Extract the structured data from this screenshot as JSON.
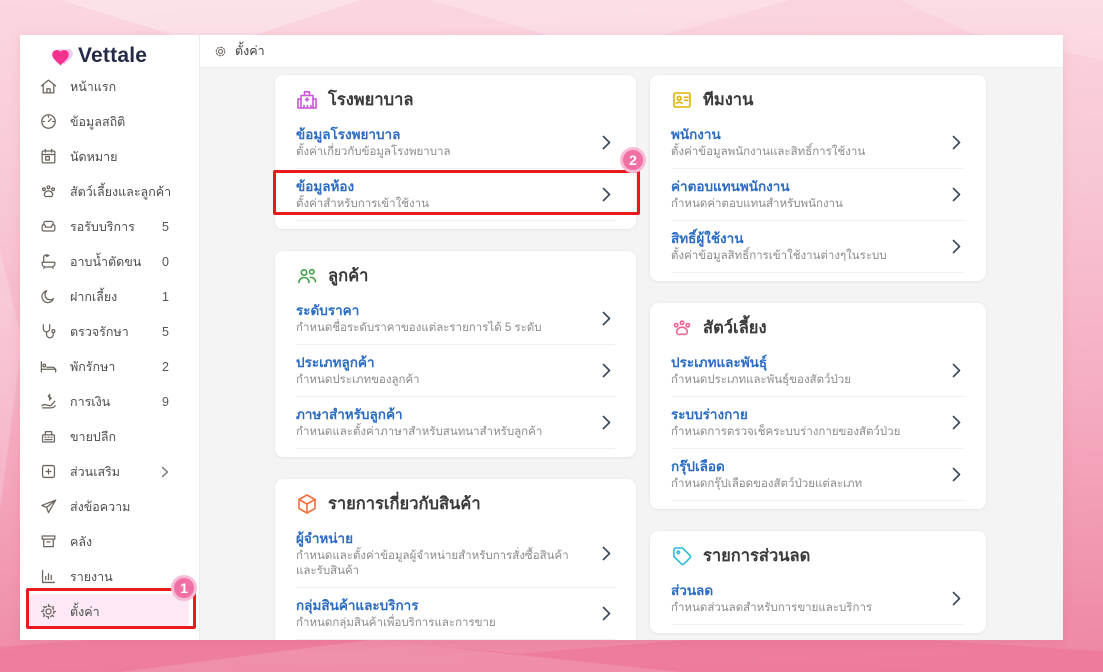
{
  "app": {
    "logo_text": "Vettale"
  },
  "header": {
    "title": "ตั้งค่า",
    "icon": "gear-icon"
  },
  "sidebar": {
    "items": [
      {
        "label": "หน้าแรก",
        "icon": "home-icon"
      },
      {
        "label": "ข้อมูลสถิติ",
        "icon": "stats-gauge-icon"
      },
      {
        "label": "นัดหมาย",
        "icon": "calendar-icon"
      },
      {
        "label": "สัตว์เลี้ยงและลูกค้า",
        "icon": "paw-icon"
      },
      {
        "label": "รอรับบริการ",
        "count": "5",
        "icon": "sofa-icon"
      },
      {
        "label": "อาบน้ำตัดขน",
        "count": "0",
        "icon": "bathtub-icon"
      },
      {
        "label": "ฝากเลี้ยง",
        "count": "1",
        "icon": "moon-icon"
      },
      {
        "label": "ตรวจรักษา",
        "count": "5",
        "icon": "stethoscope-icon"
      },
      {
        "label": "พักรักษา",
        "count": "2",
        "icon": "bed-icon"
      },
      {
        "label": "การเงิน",
        "count": "9",
        "icon": "money-hand-icon"
      },
      {
        "label": "ขายปลีก",
        "icon": "cash-register-icon"
      },
      {
        "label": "ส่วนเสริม",
        "icon": "plus-box-icon",
        "has_submenu": true
      },
      {
        "label": "ส่งข้อความ",
        "icon": "paper-plane-icon"
      },
      {
        "label": "คลัง",
        "icon": "inventory-box-icon"
      },
      {
        "label": "รายงาน",
        "icon": "report-chart-icon"
      },
      {
        "label": "ตั้งค่า",
        "icon": "gear-icon",
        "active": true
      }
    ]
  },
  "cards": {
    "hospital": {
      "title": "โรงพยาบาล",
      "icon": "hospital-icon",
      "icon_color": "#cb54d8",
      "items": [
        {
          "title": "ข้อมูลโรงพยาบาล",
          "desc": "ตั้งค่าเกี่ยวกับข้อมูลโรงพยาบาล"
        },
        {
          "title": "ข้อมูลห้อง",
          "desc": "ตั้งค่าสำหรับการเข้าใช้งาน"
        }
      ]
    },
    "customer": {
      "title": "ลูกค้า",
      "icon": "people-group-icon",
      "icon_color": "#43a047",
      "items": [
        {
          "title": "ระดับราคา",
          "desc": "กำหนดชื่อระดับราคาของแต่ละรายการได้ 5 ระดับ"
        },
        {
          "title": "ประเภทลูกค้า",
          "desc": "กำหนดประเภทของลูกค้า"
        },
        {
          "title": "ภาษาสำหรับลูกค้า",
          "desc": "กำหนดและตั้งค่าภาษาสำหรับสนทนาสำหรับลูกค้า"
        }
      ]
    },
    "product": {
      "title": "รายการเกี่ยวกับสินค้า",
      "icon": "cube-icon",
      "icon_color": "#f2703d",
      "items": [
        {
          "title": "ผู้จำหน่าย",
          "desc": "กำหนดและตั้งค่าข้อมูลผู้จำหน่ายสำหรับการสั่งซื้อสินค้าและรับสินค้า"
        },
        {
          "title": "กลุ่มสินค้าและบริการ",
          "desc": "กำหนดกลุ่มสินค้าเพื่อบริการและการขาย"
        }
      ]
    },
    "team": {
      "title": "ทีมงาน",
      "icon": "id-badge-icon",
      "icon_color": "#e0b400",
      "items": [
        {
          "title": "พนักงาน",
          "desc": "ตั้งค่าข้อมูลพนักงานและสิทธิ์การใช้งาน"
        },
        {
          "title": "ค่าตอบแทนพนักงาน",
          "desc": "กำหนดค่าตอบแทนสำหรับพนักงาน"
        },
        {
          "title": "สิทธิ์ผู้ใช้งาน",
          "desc": "ตั้งค่าข้อมูลสิทธิ์การเข้าใช้งานต่างๆในระบบ"
        }
      ]
    },
    "pet": {
      "title": "สัตว์เลี้ยง",
      "icon": "paw-icon",
      "icon_color": "#ef6492",
      "items": [
        {
          "title": "ประเภทและพันธุ์",
          "desc": "กำหนดประเภทและพันธุ์ของสัตว์ป่วย"
        },
        {
          "title": "ระบบร่างกาย",
          "desc": "กำหนดการตรวจเช็คระบบร่างกายของสัตว์ป่วย"
        },
        {
          "title": "กรุ๊ปเลือด",
          "desc": "กำหนดกรุ๊ปเลือดของสัตว์ป่วยแต่ละเภท"
        }
      ]
    },
    "discount": {
      "title": "รายการส่วนลด",
      "icon": "tag-icon",
      "icon_color": "#2ebcd8",
      "items": [
        {
          "title": "ส่วนลด",
          "desc": "กำหนดส่วนลดสำหรับการขายและบริการ"
        }
      ]
    }
  },
  "annotations": {
    "step1": "1",
    "step2": "2",
    "box_color": "#e8191f",
    "badge_color": "#f06fa5"
  },
  "colors": {
    "link_blue": "#2b6cc4",
    "desc_gray": "#8b8b8b",
    "content_bg": "#f4f4f5",
    "active_item_bg": "#fce9f5",
    "brand_pink": "#f5338f"
  }
}
